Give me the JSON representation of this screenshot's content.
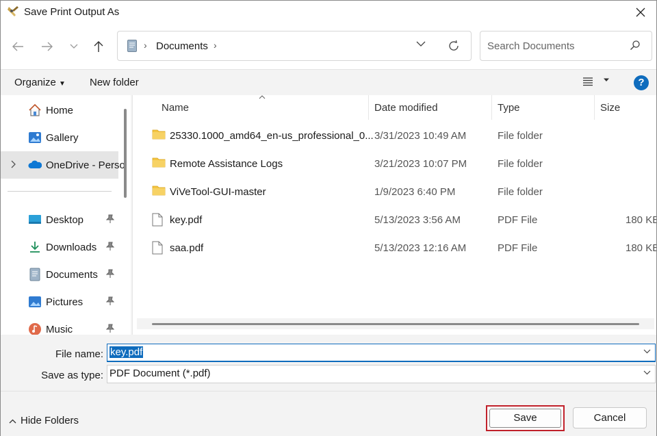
{
  "window": {
    "title": "Save Print Output As"
  },
  "address": {
    "current": "Documents"
  },
  "search": {
    "placeholder": "Search Documents"
  },
  "commands": {
    "organize": "Organize",
    "new_folder": "New folder",
    "help": "?"
  },
  "nav": {
    "items": [
      {
        "label": "Home",
        "icon": "home-icon"
      },
      {
        "label": "Gallery",
        "icon": "gallery-icon"
      },
      {
        "label": "OneDrive - Perso",
        "icon": "onedrive-icon",
        "selected": true
      },
      {
        "label": "Desktop",
        "icon": "desktop-icon"
      },
      {
        "label": "Downloads",
        "icon": "downloads-icon"
      },
      {
        "label": "Documents",
        "icon": "documents-icon"
      },
      {
        "label": "Pictures",
        "icon": "pictures-icon"
      },
      {
        "label": "Music",
        "icon": "music-icon"
      }
    ]
  },
  "columns": {
    "name": "Name",
    "date": "Date modified",
    "type": "Type",
    "size": "Size"
  },
  "files": [
    {
      "name": "25330.1000_amd64_en-us_professional_0...",
      "date": "3/31/2023 10:49 AM",
      "type": "File folder",
      "size": "",
      "kind": "folder"
    },
    {
      "name": "Remote Assistance Logs",
      "date": "3/21/2023 10:07 PM",
      "type": "File folder",
      "size": "",
      "kind": "folder"
    },
    {
      "name": "ViVeTool-GUI-master",
      "date": "1/9/2023 6:40 PM",
      "type": "File folder",
      "size": "",
      "kind": "folder"
    },
    {
      "name": "key.pdf",
      "date": "5/13/2023 3:56 AM",
      "type": "PDF File",
      "size": "180 KB",
      "kind": "file"
    },
    {
      "name": "saa.pdf",
      "date": "5/13/2023 12:16 AM",
      "type": "PDF File",
      "size": "180 KB",
      "kind": "file"
    }
  ],
  "form": {
    "file_name_label": "File name:",
    "file_name_value": "key.pdf",
    "save_type_label": "Save as type:",
    "save_type_value": "PDF Document (*.pdf)"
  },
  "footer": {
    "hide_folders": "Hide Folders",
    "save": "Save",
    "cancel": "Cancel"
  },
  "colors": {
    "accent": "#0f6cbd",
    "highlight_border": "#c0202a",
    "folder": "#f4c542"
  }
}
